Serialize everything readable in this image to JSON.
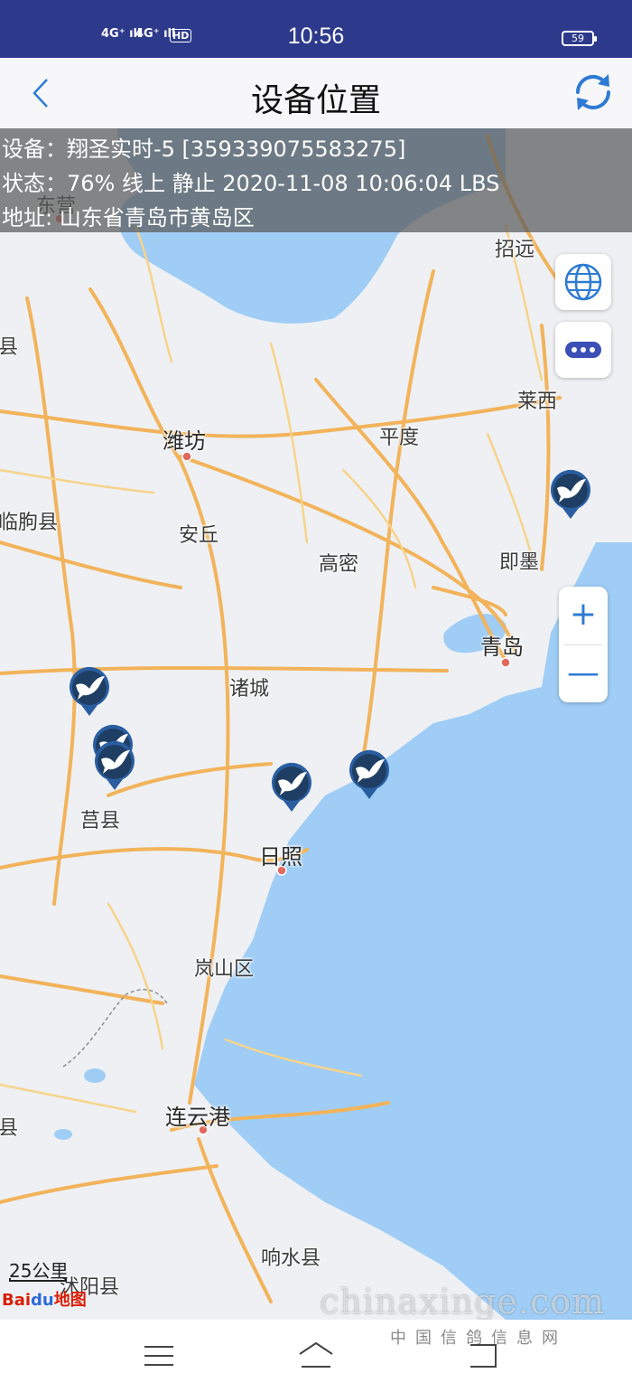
{
  "status_bar": {
    "signal1": "4G⁺ ıll",
    "signal2": "4G⁺ ıll",
    "hd": "HD",
    "time": "10:56",
    "battery": "59"
  },
  "header": {
    "title": "设备位置",
    "back_icon": "chevron-left-icon",
    "refresh_icon": "refresh-icon",
    "accent_color": "#2e7bd3"
  },
  "info": {
    "device": "设备：翔圣实时-5 [359339075583275]",
    "status": "状态：76% 线上  静止  2020-11-08 10:06:04 LBS",
    "address": "地址: 山东省青岛市黄岛区"
  },
  "map": {
    "places": {
      "dongying": "东营",
      "zhaoyuan": "招远",
      "xian": "县",
      "laixi": "莱西",
      "weifang": "潍坊",
      "pingdu": "平度",
      "linqu": "临朐县",
      "anqiu": "安丘",
      "gaomi": "高密",
      "jimo": "即墨",
      "qingdao": "青岛",
      "zhucheng": "诸城",
      "juxian": "莒县",
      "rizhao": "日照",
      "lanshan": "岚山区",
      "lianyungang": "连云港",
      "xian2": "县",
      "xiangshui": "响水县",
      "shuyang": "沭阳县"
    },
    "controls": {
      "globe_icon": "globe-icon",
      "more_icon": "more-icon",
      "zoom_in": "+",
      "zoom_out": "—"
    },
    "scale": "25公里",
    "logo_a": "Bai",
    "logo_b": "du",
    "logo_c": "地图",
    "marker_icon": "pigeon-marker-icon"
  },
  "watermark": {
    "line1": "chinaxinge.com",
    "line2": "中国信鸽信息网"
  },
  "navbar": {
    "menu_icon": "menu-icon",
    "home_icon": "home-icon",
    "back_icon": "back-icon"
  }
}
